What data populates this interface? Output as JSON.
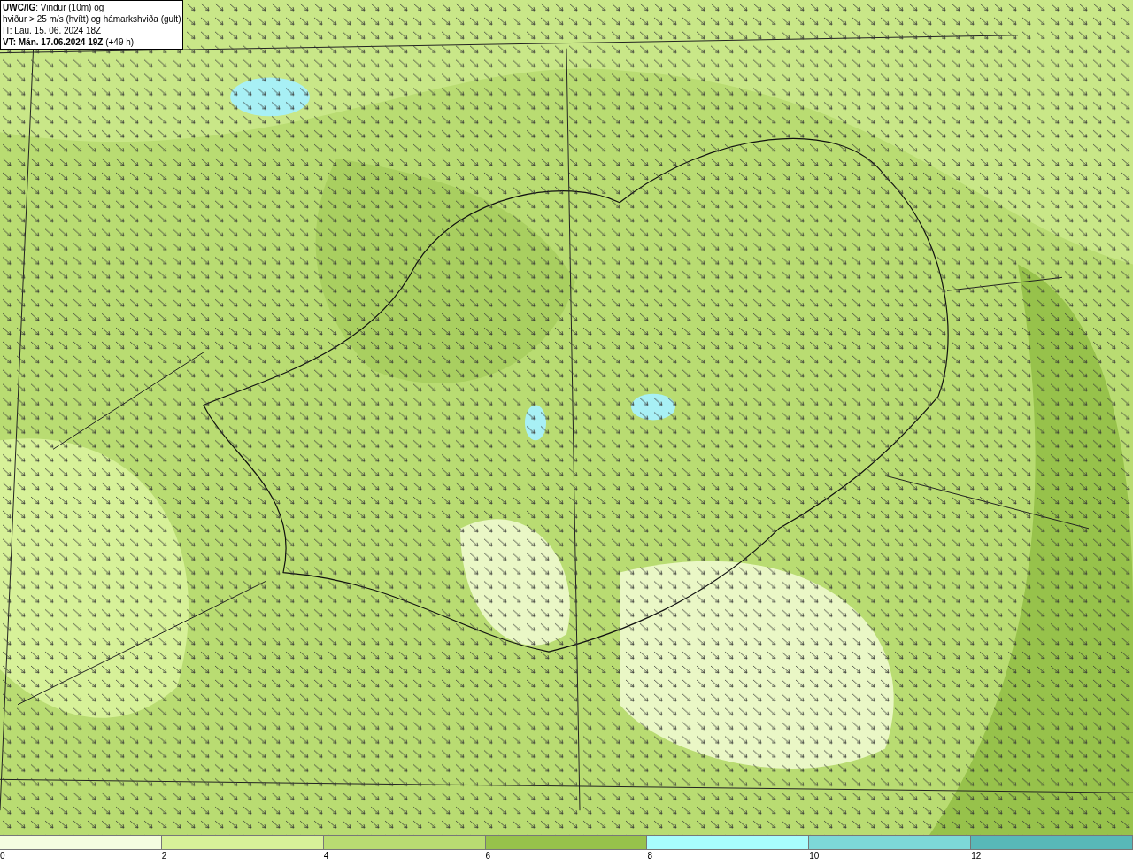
{
  "legend_box": {
    "lines": [
      "**UWC/IG**: Vindur (10m) og",
      "hviður > 25 m/s (hvítt) og hámarkshviða (gult)",
      "IT: Lau. 15. 06. 2024 18Z",
      "**VT: Mán. 17.06.2024 19Z** (+49 h)"
    ]
  },
  "color_scale": {
    "segments": [
      {
        "color": "#f5fde0"
      },
      {
        "color": "#d7f199"
      },
      {
        "color": "#b9dc72"
      },
      {
        "color": "#97c24b"
      },
      {
        "color": "#a8fdfd"
      },
      {
        "color": "#7dd8d8"
      },
      {
        "color": "#58b8b8"
      }
    ],
    "labels": [
      "0",
      "2",
      "4",
      "6",
      "8",
      "10",
      "12"
    ]
  }
}
